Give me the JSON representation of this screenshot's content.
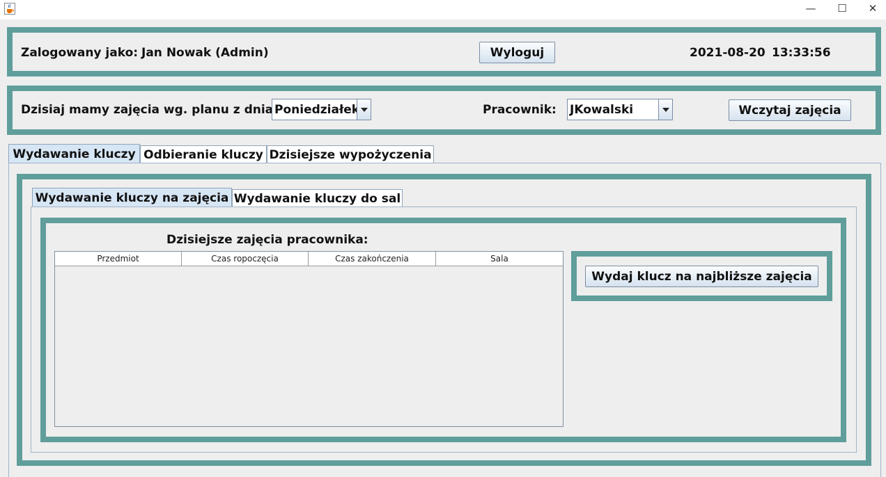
{
  "window": {
    "icon": "java-coffee-icon",
    "minimize": "—",
    "maximize": "☐",
    "close": "✕"
  },
  "header": {
    "logged_label": "Zalogowany jako:",
    "user": "Jan Nowak (Admin)",
    "logout": "Wyloguj",
    "date": "2021-08-20",
    "time": "13:33:56"
  },
  "filter": {
    "plan_label": "Dzisiaj mamy zajęcia wg. planu z dnia:",
    "plan_value": "Poniedziałek",
    "employee_label": "Pracownik:",
    "employee_value": "JKowalski",
    "load_button": "Wczytaj zajęcia"
  },
  "tabs": [
    {
      "label": "Wydawanie kluczy",
      "selected": true
    },
    {
      "label": "Odbieranie kluczy",
      "selected": false
    },
    {
      "label": "Dzisiejsze wypożyczenia",
      "selected": false
    }
  ],
  "subtabs": [
    {
      "label": "Wydawanie kluczy na zajęcia",
      "selected": true
    },
    {
      "label": "Wydawanie kluczy do sal",
      "selected": false
    }
  ],
  "classes": {
    "title": "Dzisiejsze zajęcia pracownika:",
    "columns": [
      "Przedmiot",
      "Czas ropoczęcia",
      "Czas zakończenia",
      "Sala"
    ],
    "rows": []
  },
  "issue_button": "Wydaj klucz na najbliższe zajęcia",
  "colors": {
    "frame_teal": "#5f9e9b",
    "background": "#eeeeee",
    "selected_tab": "#d7e6f5"
  }
}
